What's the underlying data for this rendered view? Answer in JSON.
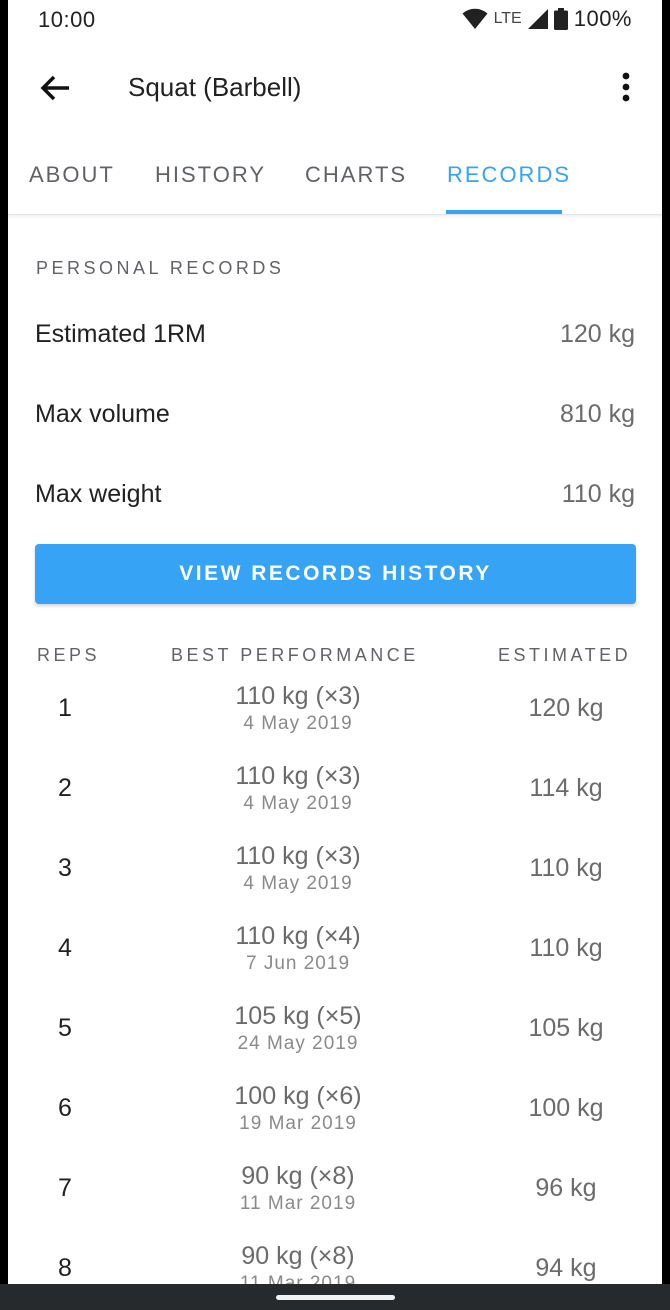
{
  "status": {
    "time": "10:00",
    "network": "LTE",
    "battery": "100%"
  },
  "appbar": {
    "title": "Squat (Barbell)",
    "back_icon": "arrow-left-icon",
    "more_icon": "more-vert-icon"
  },
  "tabs": [
    {
      "label": "ABOUT"
    },
    {
      "label": "HISTORY"
    },
    {
      "label": "CHARTS"
    },
    {
      "label": "RECORDS",
      "active": true
    }
  ],
  "personal_records": {
    "title": "PERSONAL RECORDS",
    "items": [
      {
        "label": "Estimated 1RM",
        "value": "120 kg"
      },
      {
        "label": "Max volume",
        "value": "810 kg"
      },
      {
        "label": "Max weight",
        "value": "110 kg"
      }
    ],
    "button_label": "VIEW RECORDS HISTORY"
  },
  "reps_table": {
    "headers": {
      "reps": "REPS",
      "best": "BEST PERFORMANCE",
      "estimated": "ESTIMATED"
    },
    "rows": [
      {
        "reps": "1",
        "best": "110 kg (×3)",
        "date": "4 May 2019",
        "estimated": "120 kg"
      },
      {
        "reps": "2",
        "best": "110 kg (×3)",
        "date": "4 May 2019",
        "estimated": "114 kg"
      },
      {
        "reps": "3",
        "best": "110 kg (×3)",
        "date": "4 May 2019",
        "estimated": "110 kg"
      },
      {
        "reps": "4",
        "best": "110 kg (×4)",
        "date": "7 Jun 2019",
        "estimated": "110 kg"
      },
      {
        "reps": "5",
        "best": "105 kg (×5)",
        "date": "24 May 2019",
        "estimated": "105 kg"
      },
      {
        "reps": "6",
        "best": "100 kg (×6)",
        "date": "19 Mar 2019",
        "estimated": "100 kg"
      },
      {
        "reps": "7",
        "best": "90 kg (×8)",
        "date": "11 Mar 2019",
        "estimated": "96 kg"
      },
      {
        "reps": "8",
        "best": "90 kg (×8)",
        "date": "11 Mar 2019",
        "estimated": "94 kg"
      }
    ]
  },
  "colors": {
    "accent": "#36a3f5",
    "text_primary": "#212121",
    "text_secondary": "#6b6b6b"
  }
}
